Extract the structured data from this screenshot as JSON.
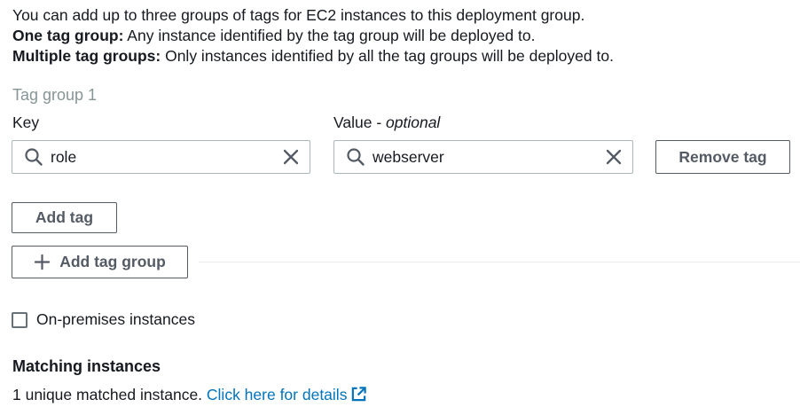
{
  "intro": {
    "line1": "You can add up to three groups of tags for EC2 instances to this deployment group.",
    "line2_bold": "One tag group:",
    "line2_rest": " Any instance identified by the tag group will be deployed to.",
    "line3_bold": "Multiple tag groups:",
    "line3_rest": " Only instances identified by all the tag groups will be deployed to."
  },
  "tag_group": {
    "label": "Tag group 1",
    "key_label": "Key",
    "value_label": "Value - ",
    "value_label_optional": "optional",
    "key_value": "role",
    "value_value": "webserver",
    "remove_button": "Remove tag",
    "add_tag_button": "Add tag"
  },
  "add_group_button": "Add tag group",
  "on_premises_label": "On-premises instances",
  "matching": {
    "title": "Matching instances",
    "text": "1 unique matched instance. ",
    "link": "Click here for details"
  },
  "colors": {
    "link": "#0073bb",
    "button_border": "#545b64",
    "muted": "#879596"
  },
  "icons": {
    "search": "search-icon",
    "clear": "close-icon",
    "plus": "plus-icon",
    "external": "external-link-icon"
  }
}
